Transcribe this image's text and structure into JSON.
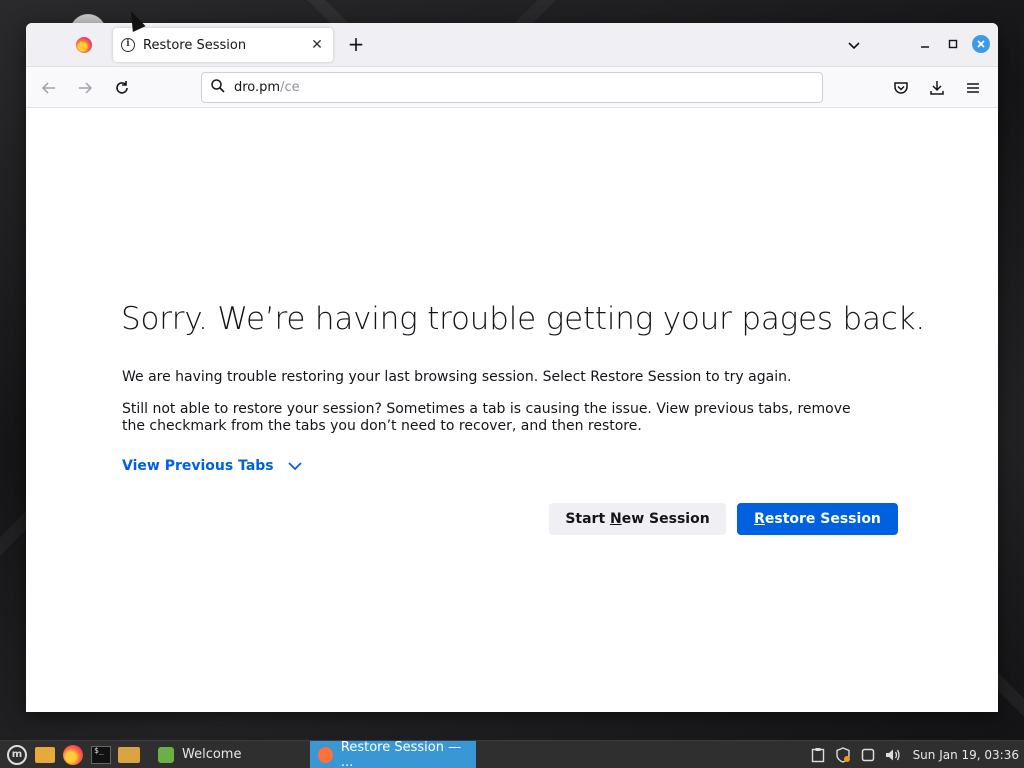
{
  "browser": {
    "tab_title": "Restore Session",
    "url_host": "dro.pm",
    "url_path": "/ce"
  },
  "page": {
    "headline": "Sorry. We’re having trouble getting your pages back.",
    "paragraph1": "We are having trouble restoring your last browsing session. Select Restore Session to try again.",
    "paragraph2": "Still not able to restore your session? Sometimes a tab is causing the issue. View previous tabs, remove the checkmark from the tabs you don’t need to recover, and then restore.",
    "view_previous_tabs": "View Previous Tabs",
    "start_new_session": {
      "pre": "Start ",
      "accesskey": "N",
      "post": "ew Session"
    },
    "restore_session": {
      "pre": "",
      "accesskey": "R",
      "post": "estore Session"
    }
  },
  "taskbar": {
    "task_welcome": "Welcome",
    "task_active": "Restore Session — ...",
    "clock": "Sun Jan 19, 03:36"
  },
  "colors": {
    "accent": "#0061e0",
    "taskbar_active": "#3a97d6"
  },
  "icons": [
    "firefox-icon",
    "info-icon",
    "close-icon",
    "plus-icon",
    "chevron-down-icon",
    "minimize-icon",
    "maximize-icon",
    "back-icon",
    "forward-icon",
    "reload-icon",
    "search-icon",
    "pocket-icon",
    "download-icon",
    "menu-icon"
  ]
}
